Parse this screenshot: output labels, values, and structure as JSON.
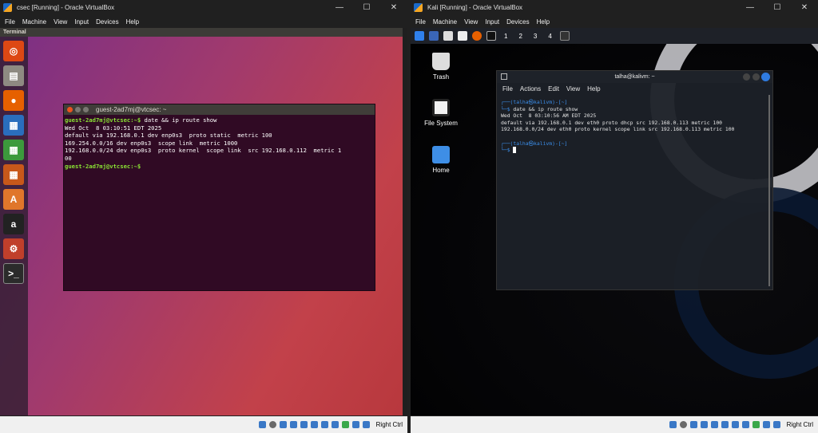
{
  "window_left": {
    "title": "csec [Running] - Oracle VirtualBox",
    "menu": [
      "File",
      "Machine",
      "View",
      "Input",
      "Devices",
      "Help"
    ],
    "guest_top_label": "Terminal",
    "terminal": {
      "title": "guest-2ad7mj@vtcsec: ~",
      "prompt": "guest-2ad7mj@vtcsec:~$",
      "command": " date && ip route show",
      "output": [
        "Wed Oct  8 03:10:51 EDT 2025",
        "default via 192.168.0.1 dev enp0s3  proto static  metric 100",
        "169.254.0.0/16 dev enp0s3  scope link  metric 1000",
        "192.168.0.0/24 dev enp0s3  proto kernel  scope link  src 192.168.0.112  metric 1",
        "00"
      ],
      "prompt2": "guest-2ad7mj@vtcsec:~$"
    },
    "status": "Right Ctrl"
  },
  "window_right": {
    "title": "Kali [Running] - Oracle VirtualBox",
    "menu": [
      "File",
      "Machine",
      "View",
      "Input",
      "Devices",
      "Help"
    ],
    "workspaces": [
      "1",
      "2",
      "3",
      "4"
    ],
    "desktop_icons": [
      "Trash",
      "File System",
      "Home"
    ],
    "terminal": {
      "title": "talha@kalivm: ~",
      "menu": [
        "File",
        "Actions",
        "Edit",
        "View",
        "Help"
      ],
      "prompt_user": "(talha㉿kalivm)-[~]",
      "command": "date && ip route show",
      "output": [
        "Wed Oct  8 03:10:56 AM EDT 2025",
        "default via 192.168.0.1 dev eth0 proto dhcp src 192.168.0.113 metric 100",
        "192.168.0.0/24 dev eth0 proto kernel scope link src 192.168.0.113 metric 100"
      ]
    },
    "status": "Right Ctrl"
  }
}
